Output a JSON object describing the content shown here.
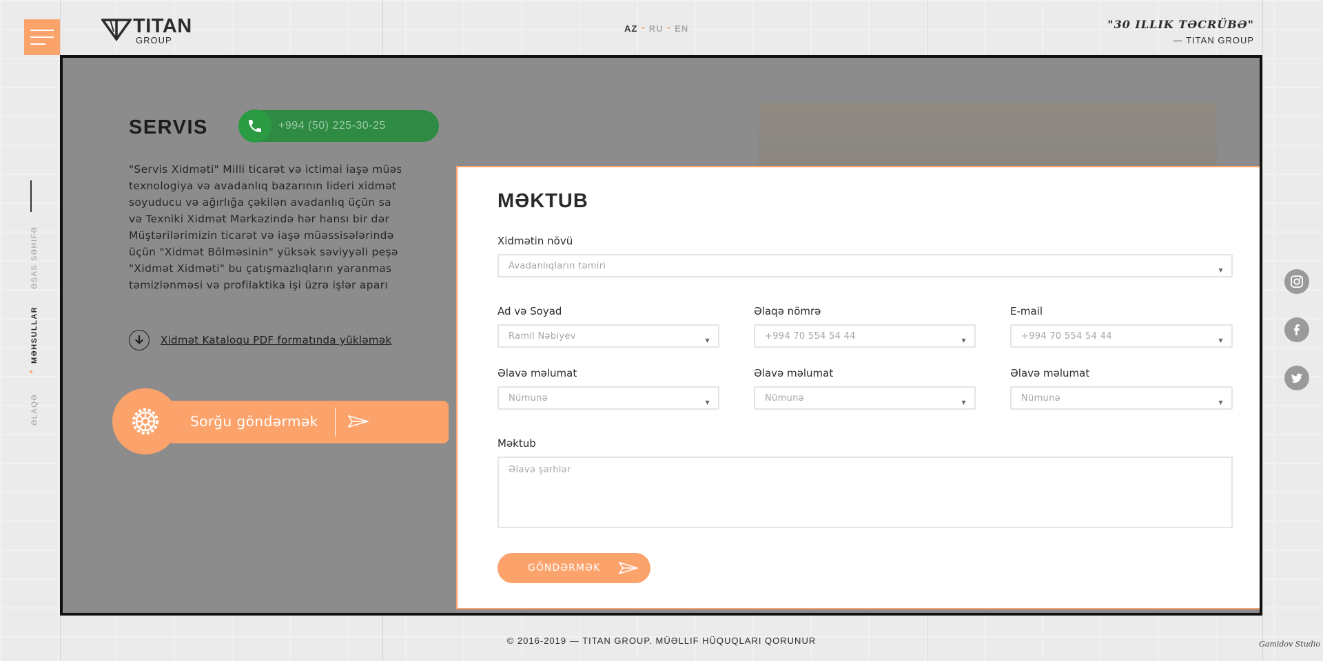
{
  "header": {
    "logo_main": "TITAN",
    "logo_sub": "GROUP",
    "languages": [
      {
        "code": "AZ",
        "active": true
      },
      {
        "code": "RU",
        "active": false
      },
      {
        "code": "EN",
        "active": false
      }
    ],
    "motto_quote": "\"30 ILLIK TƏCRÜBƏ\"",
    "motto_author": "— TITAN GROUP"
  },
  "side_nav": {
    "items": [
      {
        "label": "Əsas səhifə",
        "active": false
      },
      {
        "label": "Məhsullar",
        "active": true
      },
      {
        "label": "Əlaqə",
        "active": false
      }
    ]
  },
  "social": [
    "instagram-icon",
    "facebook-icon",
    "twitter-icon"
  ],
  "service": {
    "title": "SERVIS",
    "phone": "+994 (50) 225-30-25",
    "text_lines": [
      "\"Servis Xidməti\" Milli ticarət və ictimai iaşə müəssisələrinin",
      "texnologiya və avadanlıq bazarının lideri xidmət",
      "soyuducu və ağırlığa çəkilən avadanlıq üçün sa",
      "və Texniki Xidmət Mərkəzində hər hansı bir dər",
      "Müştərilərimizin ticarət və iaşə müəssisələrində",
      "üçün \"Xidmət Bölməsinin\" yüksək səviyyəli peşə",
      "\"Xidmət Xidməti\" bu çatışmazlıqların yaranmas",
      "təmizlənməsi və profilaktika işi üzrə işlər aparı"
    ],
    "download_label": "Xidmət Kataloqu PDF formatında yükləmək",
    "request_label": "Sorğu göndərmək"
  },
  "modal": {
    "title": "MƏKTUB",
    "service_type": {
      "label": "Xidmətin növü",
      "value": "Avadanlıqların təmiri"
    },
    "row1": [
      {
        "label": "Ad və Soyad",
        "value": "Ramil Nəbiyev"
      },
      {
        "label": "Əlaqə nömrə",
        "value": "+994 70 554 54 44"
      },
      {
        "label": "E-mail",
        "value": "+994 70 554 54 44"
      }
    ],
    "row2": [
      {
        "label": "Əlavə məlumat",
        "value": "Nümunə"
      },
      {
        "label": "Əlavə məlumat",
        "value": "Nümunə"
      },
      {
        "label": "Əlavə məlumat",
        "value": "Nümunə"
      }
    ],
    "message": {
      "label": "Məktub",
      "placeholder": "Əlavə şərhlər"
    },
    "submit_label": "GÖNDƏRMƏK"
  },
  "footer": {
    "copyright": "© 2016-2019 — TITAN GROUP. MÜƏLLIF HÜQUQLARI QORUNUR",
    "studio": "Gamidov Studio"
  },
  "colors": {
    "accent": "#fca36c",
    "phone_green": "#2f8a43",
    "overlay": "#8c8c8c",
    "frame": "#111111"
  }
}
